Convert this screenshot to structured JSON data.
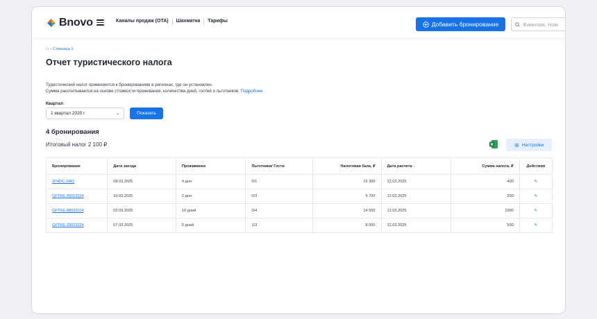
{
  "header": {
    "logo_text": "Bnovo",
    "nav": [
      "Каналы продаж (OTA)",
      "Шахматка",
      "Тарифы"
    ],
    "add_button": "Добавить бронирование",
    "search_placeholder": "Фамилия, Ном"
  },
  "breadcrumb": {
    "page": "Страница 1"
  },
  "title": "Отчет туристического налога",
  "description": {
    "line1": "Туристический налог применяется к бронированиям в регионах, где он установлен.",
    "line2": "Сумма рассчитывается на основе стоимости проживания, количества дней, гостей и льготников.",
    "link": "Подробнее"
  },
  "filter": {
    "label": "Квартал",
    "value": "1 квартал 2025 г",
    "show_button": "Показать"
  },
  "summary": {
    "count": "4 бронирования",
    "total": "Итоговый налог 2 100 ₽",
    "settings_button": "Настройки"
  },
  "table": {
    "headers": [
      "Бронирование",
      "Дата заезда",
      "Проживание",
      "Льготники/ Гости",
      "Налоговая база, ₽",
      "Дата расчета",
      "Сумма налога, ₽",
      "Действия"
    ],
    "rows": [
      [
        "3P4DC-2462",
        "08.03.2025",
        "4 дня",
        "0/1",
        "15 300",
        "12.03.2025",
        "400"
      ],
      [
        "GFTRE-05012024",
        "10.03.2025",
        "2 дня",
        "0/3",
        "5 700",
        "12.03.2025",
        "200"
      ],
      [
        "GFTRE-08032024",
        "02.03.2025",
        "10 дней",
        "0/4",
        "14 500",
        "12.03.2025",
        "1000"
      ],
      [
        "GFTRE-29022024",
        "07.03.2025",
        "5 дней",
        "1/3",
        "8 000",
        "12.03.2025",
        "500"
      ]
    ]
  },
  "colors": {
    "accent": "#1872e8",
    "excel": "#1e7a45"
  }
}
